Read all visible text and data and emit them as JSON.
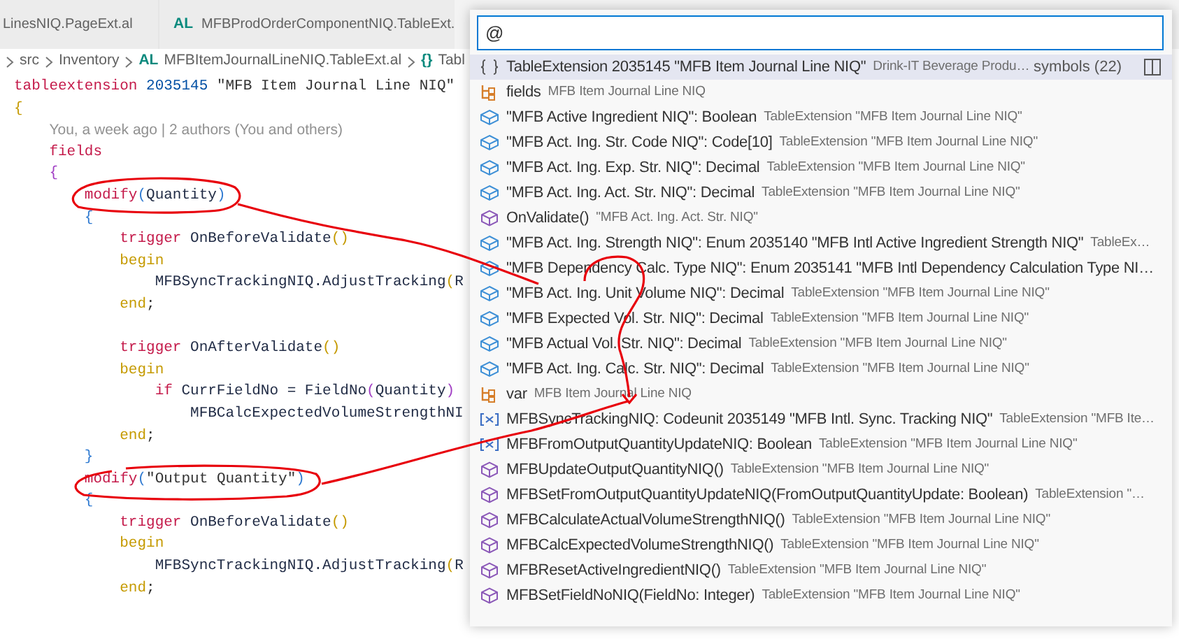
{
  "tabs": [
    {
      "label": "LinesNIQ.PageExt.al",
      "selected": false
    },
    {
      "icon_text": "AL",
      "label": "MFBProdOrderComponentNIQ.TableExt.",
      "selected": false
    }
  ],
  "breadcrumb": [
    {
      "label": "src"
    },
    {
      "label": "Inventory"
    },
    {
      "icon_text": "AL",
      "label": "MFBItemJournalLineNIQ.TableExt.al"
    },
    {
      "icon_text": "{}",
      "label": "Tabl"
    }
  ],
  "code_lines": [
    {
      "tokens": [
        {
          "kind": "kw",
          "text": "tableextension"
        },
        {
          "kind": "num",
          "text": " 2035145"
        },
        {
          "kind": "str",
          "text": " \"MFB Item Journal Line NIQ\""
        }
      ]
    },
    {
      "tokens": [
        {
          "kind": "br1",
          "text": "{"
        }
      ],
      "children": [
        {
          "codelens": "You, a week ago | 2 authors (You and others)"
        },
        {
          "tokens": [
            {
              "kind": "kw",
              "text": "fields"
            }
          ]
        },
        {
          "tokens": [
            {
              "kind": "br2",
              "text": "{"
            }
          ],
          "children": [
            {
              "tokens": [
                {
                  "kind": "kw",
                  "text": "modify"
                },
                {
                  "kind": "br3",
                  "text": "("
                },
                {
                  "kind": "id",
                  "text": "Quantity"
                },
                {
                  "kind": "br3",
                  "text": ")"
                }
              ]
            },
            {
              "tokens": [
                {
                  "kind": "br3",
                  "text": "{"
                }
              ],
              "children": [
                {
                  "tokens": [
                    {
                      "kind": "kw",
                      "text": "trigger"
                    },
                    {
                      "kind": "id",
                      "text": " OnBeforeValidate"
                    },
                    {
                      "kind": "br1",
                      "text": "()"
                    }
                  ]
                },
                {
                  "tokens": [
                    {
                      "kind": "blk",
                      "text": "begin"
                    }
                  ],
                  "children": [
                    {
                      "tokens": [
                        {
                          "kind": "id",
                          "text": "MFBSyncTrackingNIQ.AdjustTracking"
                        },
                        {
                          "kind": "br1",
                          "text": "("
                        },
                        {
                          "kind": "id",
                          "text": "R"
                        }
                      ]
                    }
                  ]
                },
                {
                  "tokens": [
                    {
                      "kind": "blk",
                      "text": "end"
                    },
                    {
                      "kind": "plain",
                      "text": ";"
                    }
                  ]
                },
                {
                  "blank_line_before": true,
                  "tokens": [
                    {
                      "kind": "kw",
                      "text": "trigger"
                    },
                    {
                      "kind": "id",
                      "text": " OnAfterValidate"
                    },
                    {
                      "kind": "br1",
                      "text": "()"
                    }
                  ]
                },
                {
                  "tokens": [
                    {
                      "kind": "blk",
                      "text": "begin"
                    }
                  ],
                  "children": [
                    {
                      "tokens": [
                        {
                          "kind": "kw",
                          "text": "if"
                        },
                        {
                          "kind": "id",
                          "text": " CurrFieldNo = FieldNo"
                        },
                        {
                          "kind": "br2",
                          "text": "("
                        },
                        {
                          "kind": "id",
                          "text": "Quantity"
                        },
                        {
                          "kind": "br2",
                          "text": ")"
                        }
                      ],
                      "children": [
                        {
                          "tokens": [
                            {
                              "kind": "id",
                              "text": "MFBCalcExpectedVolumeStrengthNI"
                            }
                          ]
                        }
                      ]
                    }
                  ]
                },
                {
                  "tokens": [
                    {
                      "kind": "blk",
                      "text": "end"
                    },
                    {
                      "kind": "plain",
                      "text": ";"
                    }
                  ]
                }
              ]
            },
            {
              "tokens": [
                {
                  "kind": "br3",
                  "text": "}"
                }
              ]
            },
            {
              "tokens": [
                {
                  "kind": "kw",
                  "text": "modify"
                },
                {
                  "kind": "br3",
                  "text": "("
                },
                {
                  "kind": "str",
                  "text": "\"Output Quantity\""
                },
                {
                  "kind": "br3",
                  "text": ")"
                }
              ]
            },
            {
              "tokens": [
                {
                  "kind": "br3",
                  "text": "{"
                }
              ],
              "children": [
                {
                  "tokens": [
                    {
                      "kind": "kw",
                      "text": "trigger"
                    },
                    {
                      "kind": "id",
                      "text": " OnBeforeValidate"
                    },
                    {
                      "kind": "br1",
                      "text": "()"
                    }
                  ]
                },
                {
                  "tokens": [
                    {
                      "kind": "blk",
                      "text": "begin"
                    }
                  ],
                  "children": [
                    {
                      "tokens": [
                        {
                          "kind": "id",
                          "text": "MFBSyncTrackingNIQ.AdjustTracking"
                        },
                        {
                          "kind": "br1",
                          "text": "("
                        },
                        {
                          "kind": "id",
                          "text": "R"
                        }
                      ]
                    }
                  ]
                },
                {
                  "tokens": [
                    {
                      "kind": "blk",
                      "text": "end"
                    },
                    {
                      "kind": "plain",
                      "text": ";"
                    }
                  ]
                }
              ]
            }
          ]
        }
      ]
    }
  ],
  "symbol_picker": {
    "value": "@",
    "results": [
      {
        "kind": "namespace",
        "label": "TableExtension 2035145 \"MFB Item Journal Line NIQ\"",
        "detail": "Drink-IT Beverage Produ…",
        "count": "symbols (22)",
        "selected": true
      },
      {
        "kind": "struct",
        "label": "fields",
        "detail": "MFB Item Journal Line NIQ",
        "selected": false
      },
      {
        "kind": "field",
        "label": "\"MFB Active Ingredient NIQ\": Boolean",
        "detail": "TableExtension \"MFB Item Journal Line NIQ\"",
        "selected": false
      },
      {
        "kind": "field",
        "label": "\"MFB Act. Ing. Str. Code NIQ\": Code[10]",
        "detail": "TableExtension \"MFB Item Journal Line NIQ\"",
        "selected": false
      },
      {
        "kind": "field",
        "label": "\"MFB Act. Ing. Exp. Str. NIQ\": Decimal",
        "detail": "TableExtension \"MFB Item Journal Line NIQ\"",
        "selected": false
      },
      {
        "kind": "field",
        "label": "\"MFB Act. Ing. Act. Str. NIQ\": Decimal",
        "detail": "TableExtension \"MFB Item Journal Line NIQ\"",
        "selected": false
      },
      {
        "kind": "method",
        "label": "OnValidate()",
        "detail": "\"MFB Act. Ing. Act. Str. NIQ\"",
        "selected": false
      },
      {
        "kind": "field",
        "label": "\"MFB Act. Ing. Strength NIQ\": Enum 2035140 \"MFB Intl Active Ingredient Strength NIQ\"",
        "detail": "TableEx…",
        "selected": false
      },
      {
        "kind": "field",
        "label": "\"MFB Dependency Calc. Type NIQ\": Enum 2035141 \"MFB Intl Dependency Calculation Type NI…",
        "selected": false
      },
      {
        "kind": "field",
        "label": "\"MFB Act. Ing. Unit Volume NIQ\": Decimal",
        "detail": "TableExtension \"MFB Item Journal Line NIQ\"",
        "selected": false
      },
      {
        "kind": "field",
        "label": "\"MFB Expected Vol. Str. NIQ\": Decimal",
        "detail": "TableExtension \"MFB Item Journal Line NIQ\"",
        "selected": false
      },
      {
        "kind": "field",
        "label": "\"MFB Actual Vol. Str. NIQ\": Decimal",
        "detail": "TableExtension \"MFB Item Journal Line NIQ\"",
        "selected": false
      },
      {
        "kind": "field",
        "label": "\"MFB Act. Ing. Calc. Str. NIQ\": Decimal",
        "detail": "TableExtension \"MFB Item Journal Line NIQ\"",
        "selected": false
      },
      {
        "kind": "struct",
        "label": "var",
        "detail": "MFB Item Journal Line NIQ",
        "selected": false
      },
      {
        "kind": "variable",
        "label": "MFBSyncTrackingNIQ: Codeunit 2035149 \"MFB Intl. Sync. Tracking NIQ\"",
        "detail": "TableExtension \"MFB Ite…",
        "selected": false
      },
      {
        "kind": "variable",
        "label": "MFBFromOutputQuantityUpdateNIQ: Boolean",
        "detail": "TableExtension \"MFB Item Journal Line NIQ\"",
        "selected": false
      },
      {
        "kind": "method",
        "label": "MFBUpdateOutputQuantityNIQ()",
        "detail": "TableExtension \"MFB Item Journal Line NIQ\"",
        "selected": false
      },
      {
        "kind": "method",
        "label": "MFBSetFromOutputQuantityUpdateNIQ(FromOutputQuantityUpdate: Boolean)",
        "detail": "TableExtension \"…",
        "selected": false
      },
      {
        "kind": "method",
        "label": "MFBCalculateActualVolumeStrengthNIQ()",
        "detail": "TableExtension \"MFB Item Journal Line NIQ\"",
        "selected": false
      },
      {
        "kind": "method",
        "label": "MFBCalcExpectedVolumeStrengthNIQ()",
        "detail": "TableExtension \"MFB Item Journal Line NIQ\"",
        "selected": false
      },
      {
        "kind": "method",
        "label": "MFBResetActiveIngredientNIQ()",
        "detail": "TableExtension \"MFB Item Journal Line NIQ\"",
        "selected": false
      },
      {
        "kind": "method",
        "label": "MFBSetFieldNoNIQ(FieldNo: Integer)",
        "detail": "TableExtension \"MFB Item Journal Line NIQ\"",
        "selected": false
      }
    ]
  }
}
